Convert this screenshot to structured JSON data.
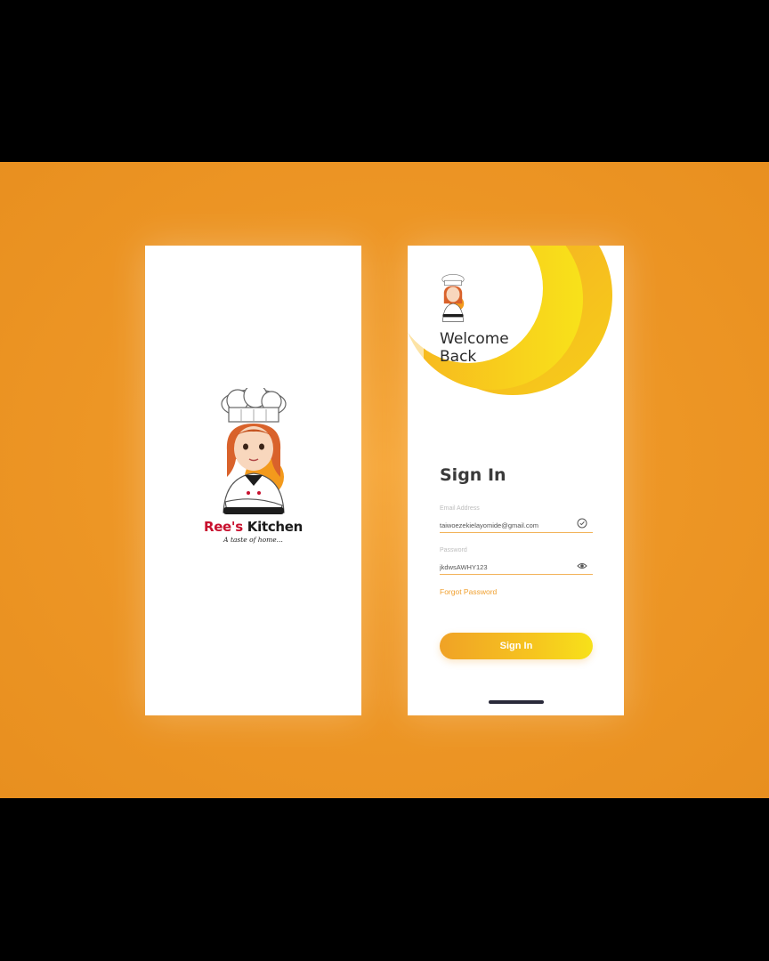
{
  "splash": {
    "brand_first": "Ree's",
    "brand_second": "Kitchen",
    "tagline": "A taste of home..."
  },
  "signin": {
    "welcome_line1": "Welcome",
    "welcome_line2": "Back",
    "title": "Sign In",
    "email": {
      "label": "Email Address",
      "value": "taiwoezekielayomide@gmail.com",
      "icon": "check-circle-icon"
    },
    "password": {
      "label": "Password",
      "value": "jkdwsAWHY123",
      "icon": "eye-icon"
    },
    "forgot_label": "Forgot Password",
    "button_label": "Sign In"
  },
  "colors": {
    "background": "#ee9726",
    "accent_orange": "#f0a226",
    "accent_yellow": "#f7e11a",
    "brand_red": "#c8102e"
  }
}
